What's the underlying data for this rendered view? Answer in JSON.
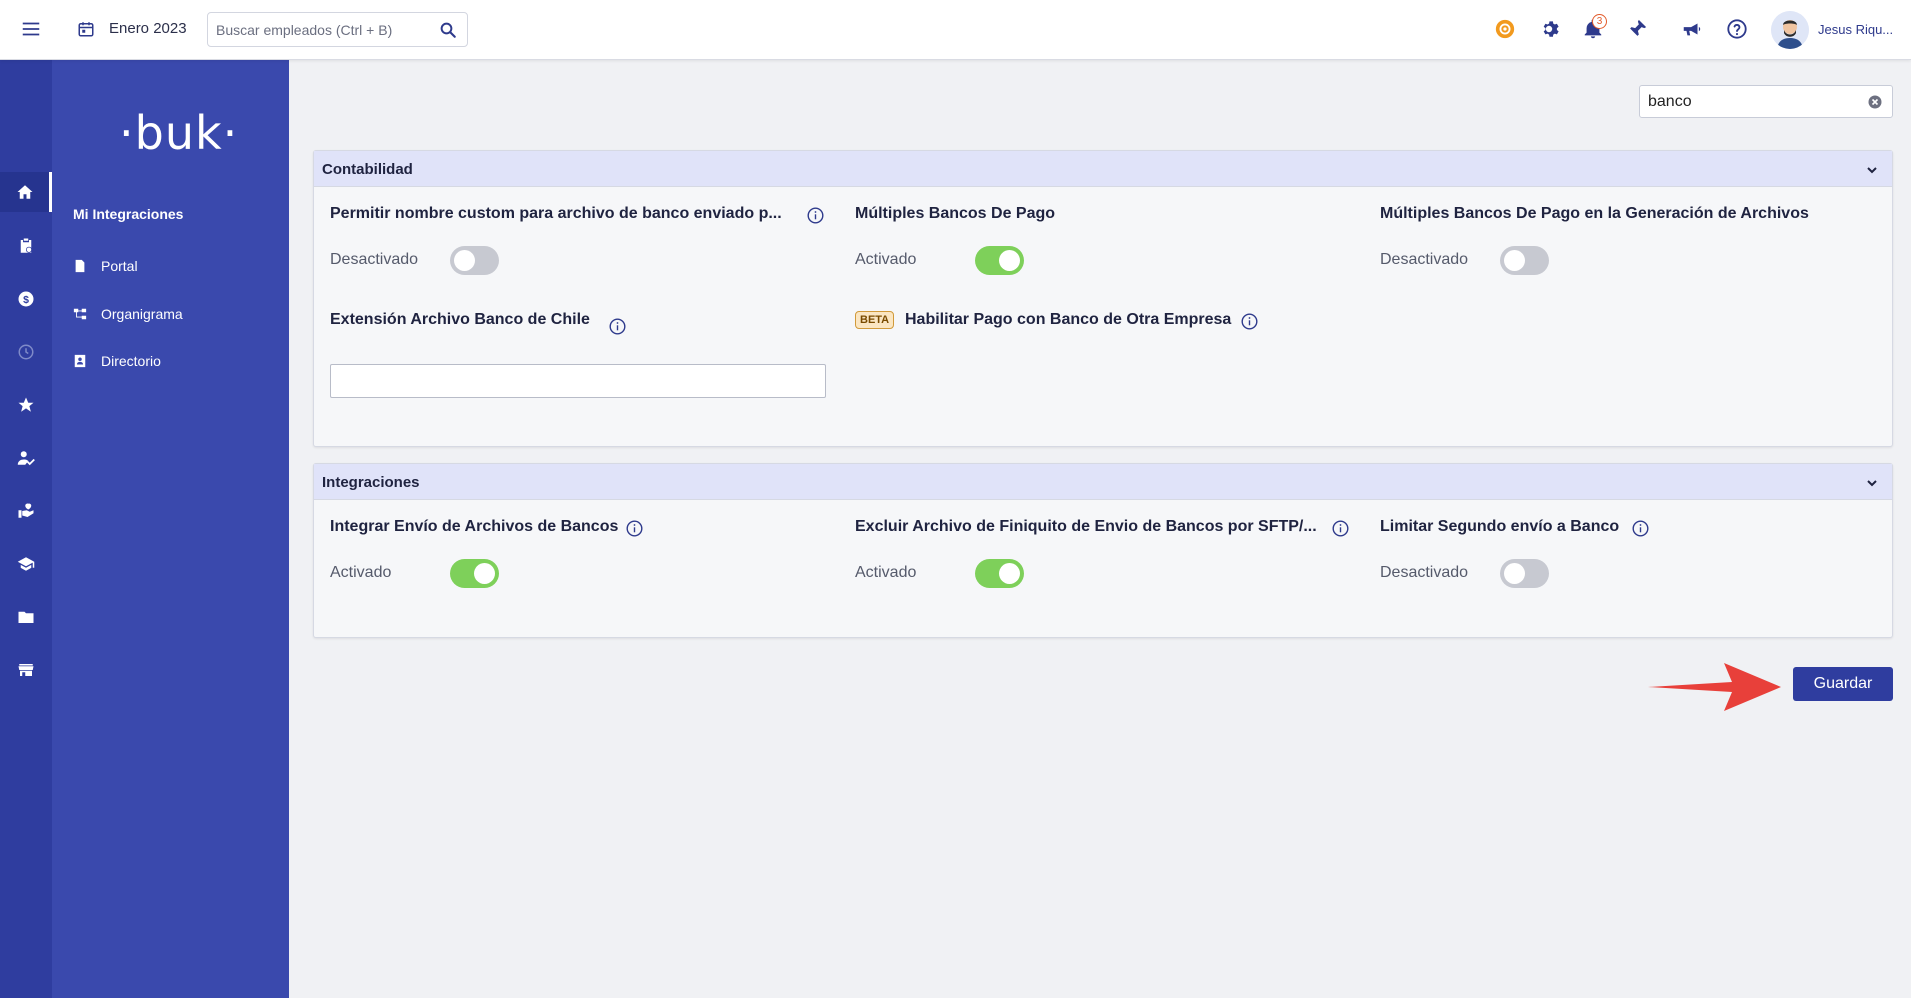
{
  "topbar": {
    "period": "Enero 2023",
    "search_placeholder": "Buscar empleados (Ctrl + B)",
    "notification_count": "3",
    "user_name": "Jesus Riqu..."
  },
  "sidebar": {
    "logo": "·buk·",
    "title": "Mi Integraciones",
    "items": [
      {
        "label": "Portal",
        "icon": "document-icon"
      },
      {
        "label": "Organigrama",
        "icon": "org-chart-icon"
      },
      {
        "label": "Directorio",
        "icon": "contact-book-icon"
      }
    ]
  },
  "rail": {
    "icons": [
      "home-icon",
      "clipboard-icon",
      "dollar-icon",
      "clock-icon",
      "star-icon",
      "user-check-icon",
      "hand-heart-icon",
      "graduation-icon",
      "folder-icon",
      "store-icon"
    ]
  },
  "filter": {
    "value": "banco"
  },
  "sections": {
    "contabilidad": {
      "title": "Contabilidad",
      "s1_label": "Permitir nombre custom para archivo de banco enviado p...",
      "s1_state": "Desactivado",
      "s1_on": false,
      "s2_label": "Múltiples Bancos De Pago",
      "s2_state": "Activado",
      "s2_on": true,
      "s3_label": "Múltiples Bancos De Pago en la Generación de Archivos",
      "s3_state": "Desactivado",
      "s3_on": false,
      "s4_label": "Extensión Archivo Banco de Chile",
      "s4_value": "",
      "s5_badge": "BETA",
      "s5_label": "Habilitar Pago con Banco de Otra Empresa"
    },
    "integraciones": {
      "title": "Integraciones",
      "s1_label": "Integrar Envío de Archivos de Bancos",
      "s1_state": "Activado",
      "s1_on": true,
      "s2_label": "Excluir Archivo de Finiquito de Envio de Bancos por SFTP/...",
      "s2_state": "Activado",
      "s2_on": true,
      "s3_label": "Limitar Segundo envío a Banco",
      "s3_state": "Desactivado",
      "s3_on": false
    }
  },
  "actions": {
    "save_label": "Guardar"
  },
  "colors": {
    "primary": "#2f3d9f",
    "sidebar": "#3a49ad",
    "toggle_on": "#7ed05a",
    "toggle_off": "#c7c9d1",
    "annotation_arrow": "#e8403a"
  }
}
